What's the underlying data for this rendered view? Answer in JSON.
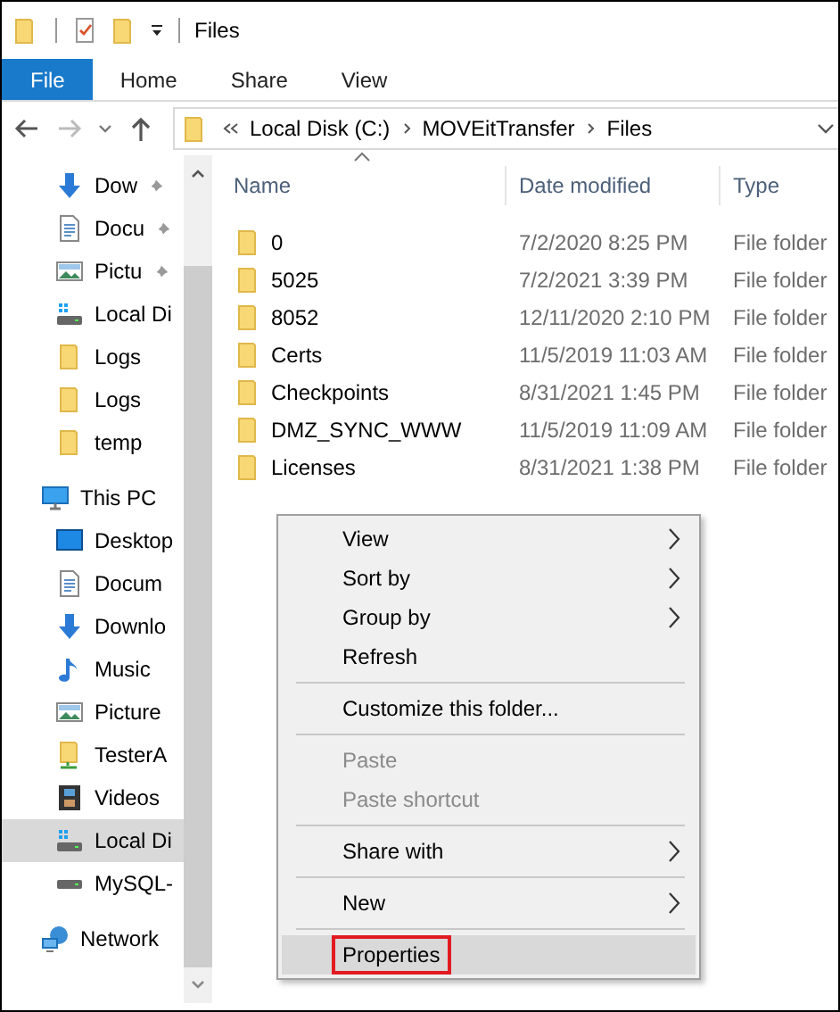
{
  "window": {
    "title": "Files"
  },
  "ribbon_tabs": [
    {
      "label": "File",
      "selected": true
    },
    {
      "label": "Home",
      "selected": false
    },
    {
      "label": "Share",
      "selected": false
    },
    {
      "label": "View",
      "selected": false
    }
  ],
  "navigation": {
    "back_disabled": false,
    "forward_disabled": true
  },
  "address_bar": {
    "path": [
      "Local Disk (C:)",
      "MOVEitTransfer",
      "Files"
    ]
  },
  "sidebar": {
    "quick_access": [
      {
        "label": "Dow",
        "kind": "download",
        "pinned": true,
        "selected": false
      },
      {
        "label": "Docu",
        "kind": "document",
        "pinned": true,
        "selected": false
      },
      {
        "label": "Pictu",
        "kind": "pictures",
        "pinned": true,
        "selected": false
      },
      {
        "label": "Local Di",
        "kind": "drive",
        "pinned": false,
        "selected": false
      },
      {
        "label": "Logs",
        "kind": "folder",
        "pinned": false,
        "selected": false
      },
      {
        "label": "Logs",
        "kind": "folder",
        "pinned": false,
        "selected": false
      },
      {
        "label": "temp",
        "kind": "folder",
        "pinned": false,
        "selected": false
      }
    ],
    "tree": [
      {
        "label": "This PC",
        "kind": "pc",
        "selected": false,
        "children": [
          {
            "label": "Desktop",
            "kind": "desktop",
            "selected": false
          },
          {
            "label": "Docum",
            "kind": "document",
            "selected": false
          },
          {
            "label": "Downlo",
            "kind": "download",
            "selected": false
          },
          {
            "label": "Music",
            "kind": "music",
            "selected": false
          },
          {
            "label": "Picture",
            "kind": "pictures",
            "selected": false
          },
          {
            "label": "TesterA",
            "kind": "user-folder",
            "selected": false
          },
          {
            "label": "Videos",
            "kind": "videos",
            "selected": false
          },
          {
            "label": "Local Di",
            "kind": "drive",
            "selected": true
          },
          {
            "label": "MySQL-",
            "kind": "drive-plain",
            "selected": false
          }
        ]
      },
      {
        "label": "Network",
        "kind": "network",
        "selected": false
      }
    ]
  },
  "file_list": {
    "columns": [
      "Name",
      "Date modified",
      "Type"
    ],
    "rows": [
      {
        "name": "0",
        "date": "7/2/2020 8:25 PM",
        "type": "File folder"
      },
      {
        "name": "5025",
        "date": "7/2/2021 3:39 PM",
        "type": "File folder"
      },
      {
        "name": "8052",
        "date": "12/11/2020 2:10 PM",
        "type": "File folder"
      },
      {
        "name": "Certs",
        "date": "11/5/2019 11:03 AM",
        "type": "File folder"
      },
      {
        "name": "Checkpoints",
        "date": "8/31/2021 1:45 PM",
        "type": "File folder"
      },
      {
        "name": "DMZ_SYNC_WWW",
        "date": "11/5/2019 11:09 AM",
        "type": "File folder"
      },
      {
        "name": "Licenses",
        "date": "8/31/2021 1:38 PM",
        "type": "File folder"
      }
    ]
  },
  "context_menu": {
    "items": [
      {
        "kind": "command",
        "label": "View",
        "submenu": true,
        "disabled": false,
        "selected": false,
        "annotated": false
      },
      {
        "kind": "command",
        "label": "Sort by",
        "submenu": true,
        "disabled": false,
        "selected": false,
        "annotated": false
      },
      {
        "kind": "command",
        "label": "Group by",
        "submenu": true,
        "disabled": false,
        "selected": false,
        "annotated": false
      },
      {
        "kind": "command",
        "label": "Refresh",
        "submenu": false,
        "disabled": false,
        "selected": false,
        "annotated": false
      },
      {
        "kind": "separator"
      },
      {
        "kind": "command",
        "label": "Customize this folder...",
        "submenu": false,
        "disabled": false,
        "selected": false,
        "annotated": false
      },
      {
        "kind": "separator"
      },
      {
        "kind": "command",
        "label": "Paste",
        "submenu": false,
        "disabled": true,
        "selected": false,
        "annotated": false
      },
      {
        "kind": "command",
        "label": "Paste shortcut",
        "submenu": false,
        "disabled": true,
        "selected": false,
        "annotated": false
      },
      {
        "kind": "separator"
      },
      {
        "kind": "command",
        "label": "Share with",
        "submenu": true,
        "disabled": false,
        "selected": false,
        "annotated": false
      },
      {
        "kind": "separator"
      },
      {
        "kind": "command",
        "label": "New",
        "submenu": true,
        "disabled": false,
        "selected": false,
        "annotated": false
      },
      {
        "kind": "separator"
      },
      {
        "kind": "command",
        "label": "Properties",
        "submenu": false,
        "disabled": false,
        "selected": true,
        "annotated": true
      }
    ]
  }
}
